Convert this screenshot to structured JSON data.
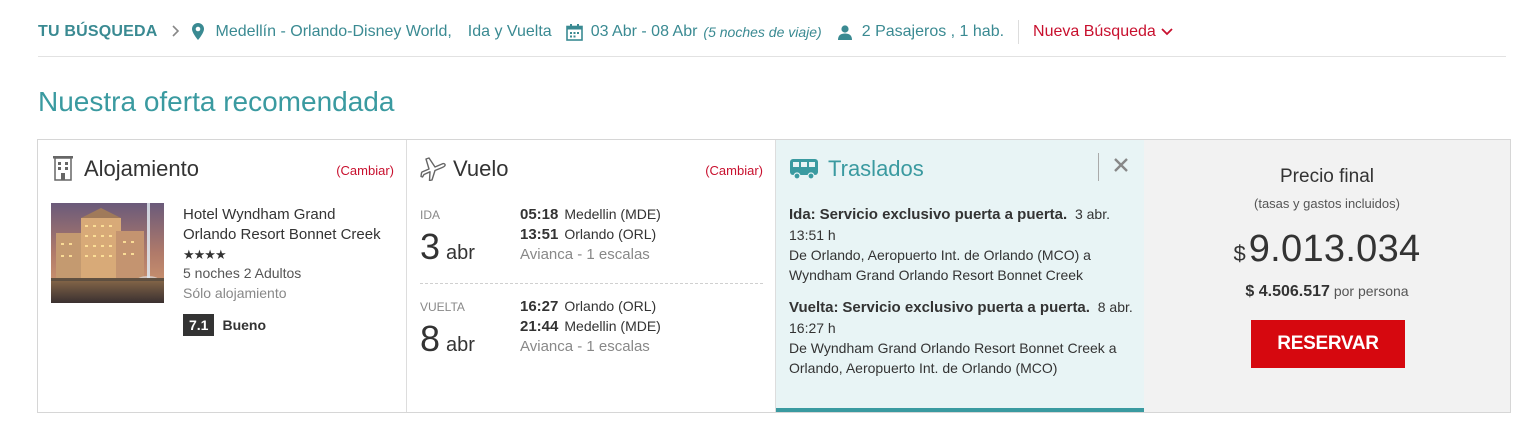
{
  "search": {
    "title": "TU BÚSQUEDA",
    "route": "Medellín - Orlando-Disney World,",
    "trip_type": "Ida y Vuelta",
    "dates": "03 Abr - 08 Abr",
    "nights": "(5 noches de viaje)",
    "passengers": "2 Pasajeros , 1 hab.",
    "new_search": "Nueva Búsqueda"
  },
  "page_title": "Nuestra oferta recomendada",
  "hotel": {
    "section_title": "Alojamiento",
    "change": "(Cambiar)",
    "name": "Hotel Wyndham Grand Orlando Resort Bonnet Creek",
    "stars_text": "★★★★",
    "stars": 4,
    "guests": "5 noches 2 Adultos",
    "board": "Sólo alojamiento",
    "score": "7.1",
    "score_label": "Bueno"
  },
  "flight": {
    "section_title": "Vuelo",
    "change": "(Cambiar)",
    "legs": [
      {
        "label": "IDA",
        "day": "3",
        "month": "abr",
        "dep_time": "05:18",
        "dep_place": "Medellin (MDE)",
        "arr_time": "13:51",
        "arr_place": "Orlando (ORL)",
        "airline": "Avianca - 1 escalas"
      },
      {
        "label": "VUELTA",
        "day": "8",
        "month": "abr",
        "dep_time": "16:27",
        "dep_place": "Orlando (ORL)",
        "arr_time": "21:44",
        "arr_place": "Medellin (MDE)",
        "airline": "Avianca - 1 escalas"
      }
    ]
  },
  "transfer": {
    "section_title": "Traslados",
    "ida_label": "Ida:",
    "ida_service": "Servicio exclusivo puerta a puerta.",
    "ida_datetime": "3 abr. 13:51 h",
    "ida_route": "De Orlando, Aeropuerto Int. de Orlando (MCO) a Wyndham Grand Orlando Resort Bonnet Creek",
    "vuelta_label": "Vuelta:",
    "vuelta_service": "Servicio exclusivo puerta a puerta.",
    "vuelta_datetime": "8 abr. 16:27 h",
    "vuelta_route": "De Wyndham Grand Orlando Resort Bonnet Creek a Orlando, Aeropuerto Int. de Orlando (MCO)"
  },
  "price": {
    "title": "Precio final",
    "subtitle": "(tasas y gastos incluidos)",
    "currency": "$",
    "total": "9.013.034",
    "per_person_amount": "$ 4.506.517",
    "per_person_label": "por persona",
    "button": "RESERVAR"
  },
  "colors": {
    "teal": "#3a9aa0",
    "red": "#c8102e",
    "button_red": "#d6080f"
  },
  "icons": [
    "chevron-right-icon",
    "map-pin-icon",
    "calendar-icon",
    "user-icon",
    "chevron-down-icon",
    "building-icon",
    "airplane-icon",
    "bus-icon",
    "close-icon"
  ]
}
